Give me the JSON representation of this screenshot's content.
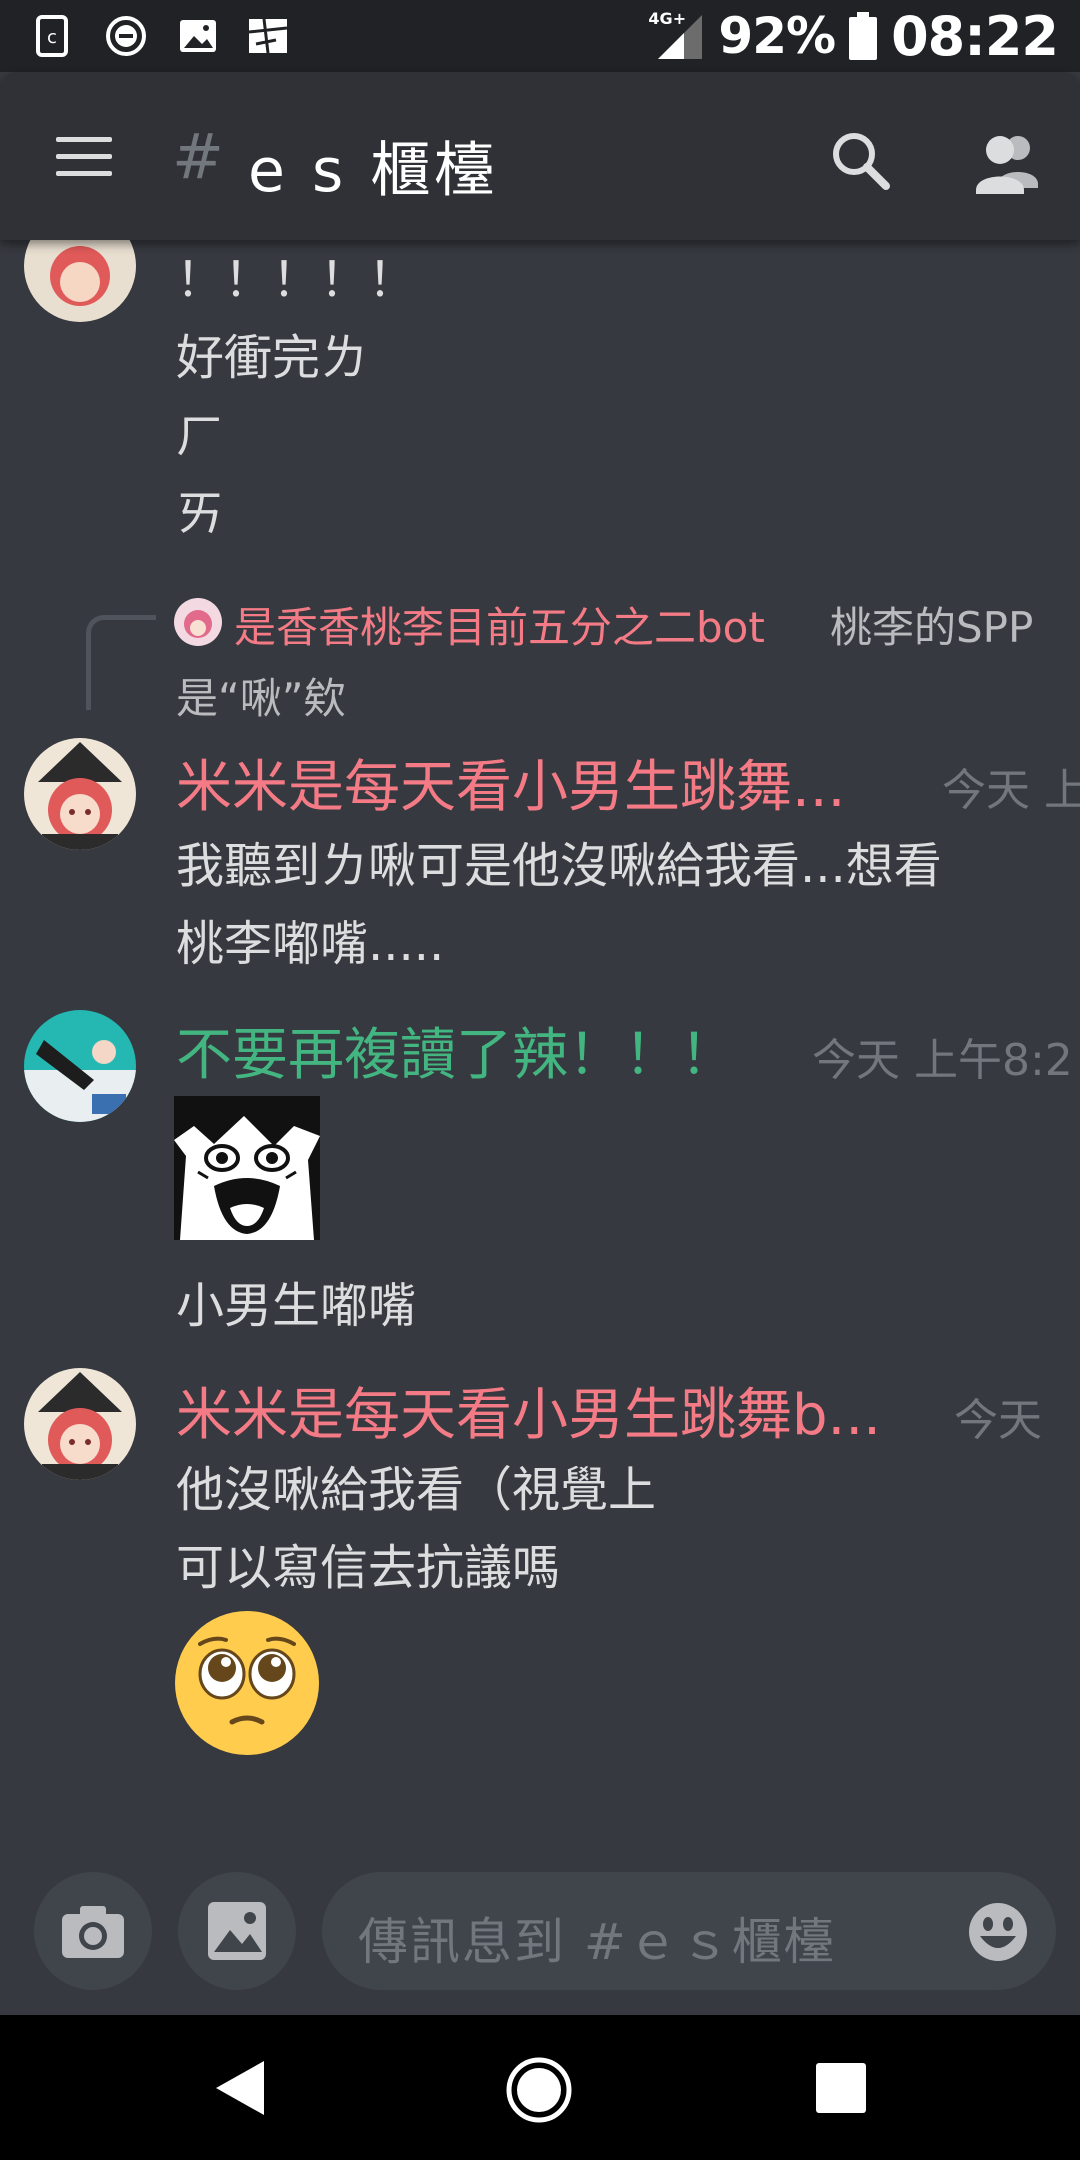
{
  "status_bar": {
    "network": "4G+",
    "battery": "92%",
    "time": "08:22"
  },
  "header": {
    "hash_symbol": "#",
    "channel_name": "e s 櫃檯",
    "menu_icon": "hamburger-icon",
    "search_icon": "search-icon",
    "members_icon": "members-icon"
  },
  "messages": [
    {
      "lines": [
        "！！！！！",
        "好衝完ㄌ",
        "ㄏ",
        "ㄞ"
      ]
    },
    {
      "reply": {
        "author": "是香香桃李目前五分之二bot",
        "text": "桃李的SPP"
      },
      "continuation": "是“啾”欸",
      "author": "米米是每天看小男生跳舞...",
      "timestamp": "今天 上",
      "author_color": "#f47b86",
      "lines": [
        "我聽到ㄌ啾可是他沒啾給我看...想看",
        "桃李嘟嘴....."
      ]
    },
    {
      "author": "不要再複讀了辣！！！",
      "timestamp": "今天 上午8:2",
      "author_color": "#43b581",
      "attachment": "manga-reaction-image",
      "lines": [
        "小男生嘟嘴"
      ]
    },
    {
      "author": "米米是每天看小男生跳舞b...",
      "timestamp": "今天",
      "author_color": "#f47b86",
      "lines": [
        "他沒啾給我看（視覺上",
        "可以寫信去抗議嗎"
      ],
      "emoji": "pleading-face-emoji"
    }
  ],
  "input_bar": {
    "placeholder": "傳訊息到 #ｅｓ櫃檯",
    "camera_icon": "camera-icon",
    "gallery_icon": "image-icon",
    "emoji_icon": "smile-icon"
  },
  "colors": {
    "background": "#36393f",
    "header": "#2f3136",
    "pink_role": "#f47b86",
    "green_role": "#43b581",
    "muted": "#72767d"
  }
}
